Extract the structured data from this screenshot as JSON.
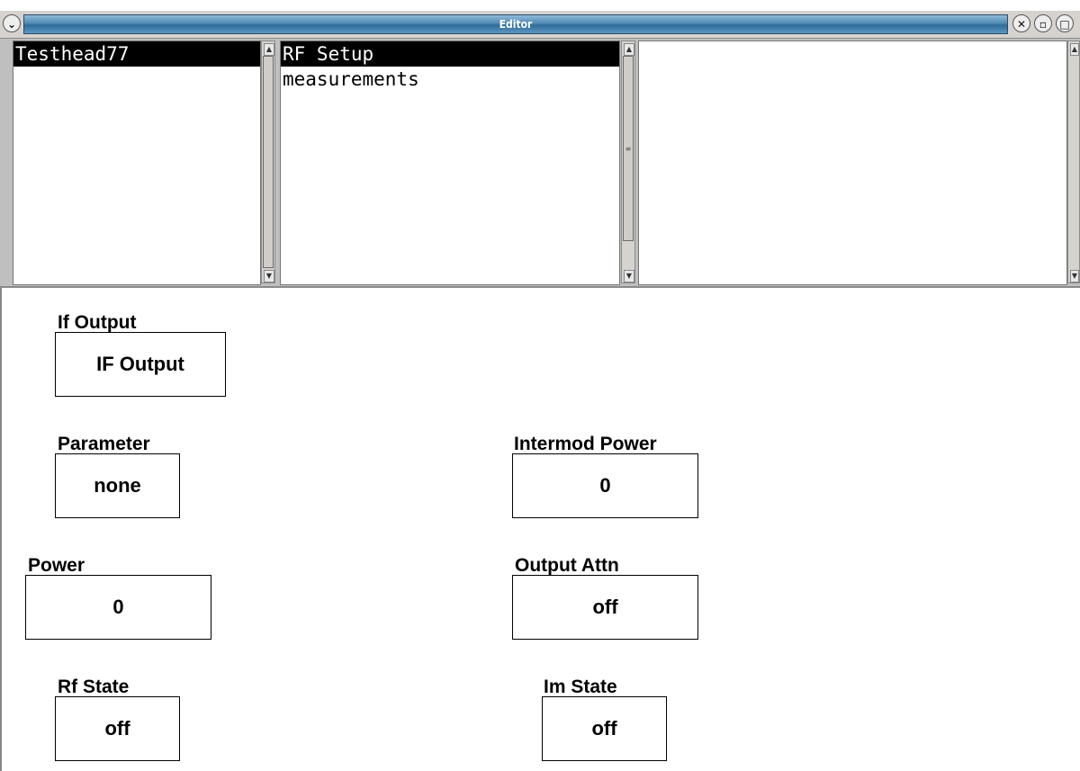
{
  "window": {
    "title": "Editor"
  },
  "lists": {
    "left": {
      "items": [
        {
          "label": "Testhead77",
          "selected": true
        }
      ]
    },
    "middle": {
      "items": [
        {
          "label": "RF Setup",
          "selected": true
        },
        {
          "label": "measurements",
          "selected": false
        }
      ]
    },
    "right": {
      "items": []
    }
  },
  "fields": {
    "if_output": {
      "label": "If Output",
      "value": "IF Output"
    },
    "parameter": {
      "label": "Parameter",
      "value": "none"
    },
    "intermod_power": {
      "label": "Intermod Power",
      "value": "0"
    },
    "power": {
      "label": "Power",
      "value": "0"
    },
    "output_attn": {
      "label": "Output Attn",
      "value": "off"
    },
    "rf_state": {
      "label": "Rf State",
      "value": "off"
    },
    "im_state": {
      "label": "Im State",
      "value": "off"
    }
  },
  "icons": {
    "menu": "chevron-down-icon",
    "close": "close-icon",
    "minimize": "minimize-icon",
    "maximize": "maximize-icon"
  },
  "colors": {
    "titlebar_accent": "#4f89b4",
    "selection_bg": "#000000",
    "selection_fg": "#ffffff"
  }
}
